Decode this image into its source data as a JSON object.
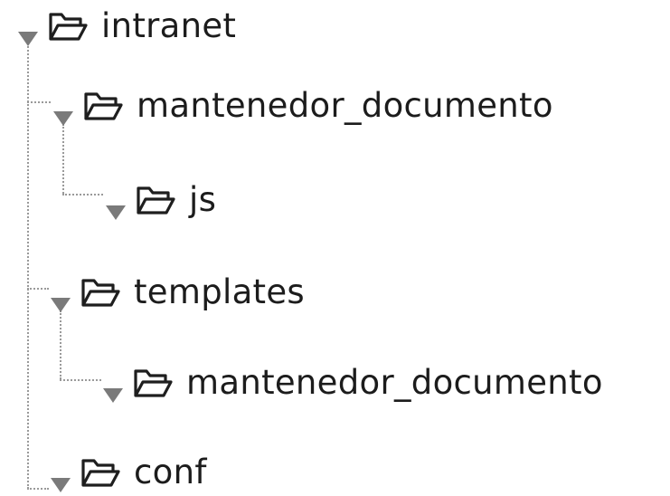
{
  "tree": {
    "nodes": [
      {
        "label": "intranet",
        "expanded": true,
        "icon": "folder-open-icon"
      },
      {
        "label": "mantenedor_documento",
        "expanded": true,
        "icon": "folder-open-icon"
      },
      {
        "label": "js",
        "expanded": true,
        "icon": "folder-open-icon"
      },
      {
        "label": "templates",
        "expanded": true,
        "icon": "folder-open-icon"
      },
      {
        "label": "mantenedor_documento",
        "expanded": true,
        "icon": "folder-open-icon"
      },
      {
        "label": "conf",
        "expanded": true,
        "icon": "folder-open-icon"
      }
    ]
  },
  "colors": {
    "expander": "#7a7a7a",
    "folder_stroke": "#1e1e1e",
    "guide": "#9a9a9a",
    "text": "#1c1c1c"
  }
}
